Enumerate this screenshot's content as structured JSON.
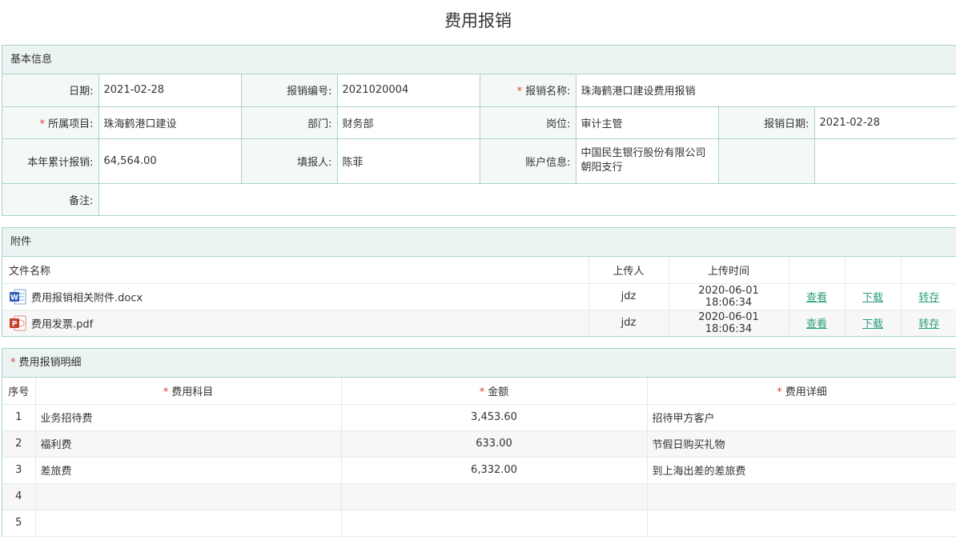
{
  "page": {
    "title": "费用报销"
  },
  "basic": {
    "heading": "基本信息",
    "date_label": "日期:",
    "date_value": "2021-02-28",
    "number_label": "报销编号:",
    "number_value": "2021020004",
    "name_label": "报销名称:",
    "name_value": "珠海鹤港口建设费用报销",
    "project_label": "所属项目:",
    "project_value": "珠海鹤港口建设",
    "dept_label": "部门:",
    "dept_value": "财务部",
    "post_label": "岗位:",
    "post_value": "审计主管",
    "reimb_date_label": "报销日期:",
    "reimb_date_value": "2021-02-28",
    "ytd_label": "本年累计报销:",
    "ytd_value": "64,564.00",
    "filler_label": "填报人:",
    "filler_value": "陈菲",
    "account_label": "账户信息:",
    "account_value": "中国民生银行股份有限公司朝阳支行",
    "remark_label": "备注:",
    "remark_value": ""
  },
  "attachments": {
    "heading": "附件",
    "col_name": "文件名称",
    "col_uploader": "上传人",
    "col_time": "上传时间",
    "rows": [
      {
        "icon": "word-file-icon",
        "name": "费用报销相关附件.docx",
        "uploader": "jdz",
        "time": "2020-06-01 18:06:34",
        "view": "查看",
        "download": "下载",
        "save": "转存"
      },
      {
        "icon": "ppt-file-icon",
        "name": "费用发票.pdf",
        "uploader": "jdz",
        "time": "2020-06-01 18:06:34",
        "view": "查看",
        "download": "下载",
        "save": "转存"
      }
    ]
  },
  "details": {
    "heading": "费用报销明细",
    "col_no": "序号",
    "col_subject": "费用科目",
    "col_amount": "金额",
    "col_detail": "费用详细",
    "rows": [
      {
        "no": "1",
        "subject": "业务招待费",
        "amount": "3,453.60",
        "detail": "招待甲方客户"
      },
      {
        "no": "2",
        "subject": "福利费",
        "amount": "633.00",
        "detail": "节假日购买礼物"
      },
      {
        "no": "3",
        "subject": "差旅费",
        "amount": "6,332.00",
        "detail": "到上海出差的差旅费"
      },
      {
        "no": "4",
        "subject": "",
        "amount": "",
        "detail": ""
      },
      {
        "no": "5",
        "subject": "",
        "amount": "",
        "detail": ""
      }
    ]
  },
  "colors": {
    "border": "#a9d2cc",
    "header_bg": "#ebf4f3",
    "link": "#2a9d7e",
    "required": "#e0413a"
  }
}
